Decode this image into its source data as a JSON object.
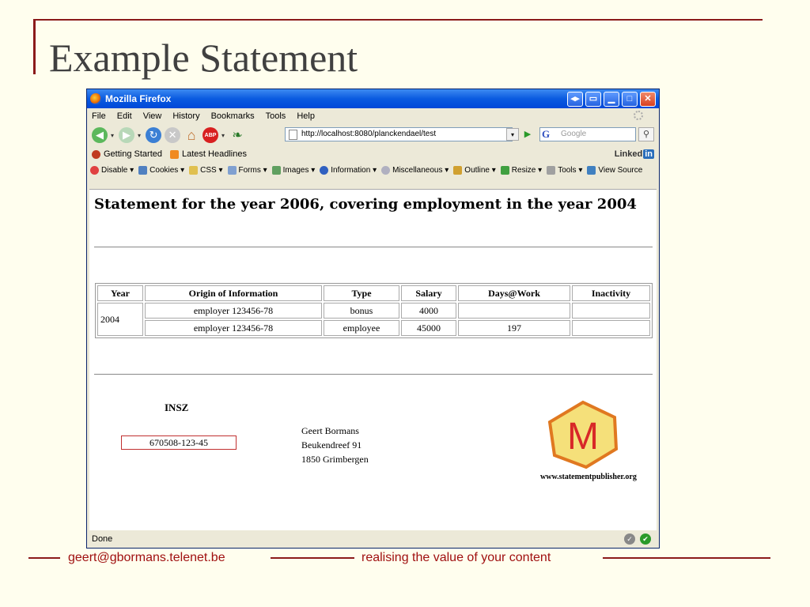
{
  "slide": {
    "title": "Example Statement",
    "footer_email": "geert@gbormans.telenet.be",
    "footer_tagline": "realising the value of your content"
  },
  "browser": {
    "title": "Mozilla Firefox",
    "menu": [
      "File",
      "Edit",
      "View",
      "History",
      "Bookmarks",
      "Tools",
      "Help"
    ],
    "url": "http://localhost:8080/planckendael/test",
    "search_placeholder": "Google",
    "bookmarks": [
      "Getting Started",
      "Latest Headlines"
    ],
    "linkedin_label": "Linked",
    "linkedin_in": "in",
    "devbar": [
      "Disable",
      "Cookies",
      "CSS",
      "Forms",
      "Images",
      "Information",
      "Miscellaneous",
      "Outline",
      "Resize",
      "Tools",
      "View Source"
    ],
    "status": "Done",
    "colors": {
      "titlebar": "#0a5ae0",
      "accent": "#8b1a1a"
    }
  },
  "page": {
    "heading": "Statement for the year 2006, covering employment in the year 2004",
    "table": {
      "headers": [
        "Year",
        "Origin of Information",
        "Type",
        "Salary",
        "Days@Work",
        "Inactivity"
      ],
      "year": "2004",
      "rows": [
        {
          "origin": "employer 123456-78",
          "type": "bonus",
          "salary": "4000",
          "days": "",
          "inactivity": ""
        },
        {
          "origin": "employer 123456-78",
          "type": "employee",
          "salary": "45000",
          "days": "197",
          "inactivity": ""
        }
      ]
    },
    "insz_label": "INSZ",
    "insz_value": "670508-123-45",
    "address": [
      "Geert Bormans",
      "Beukendreef 91",
      "1850 Grimbergen"
    ],
    "logo_letter": "M",
    "logo_url": "www.statementpublisher.org"
  }
}
